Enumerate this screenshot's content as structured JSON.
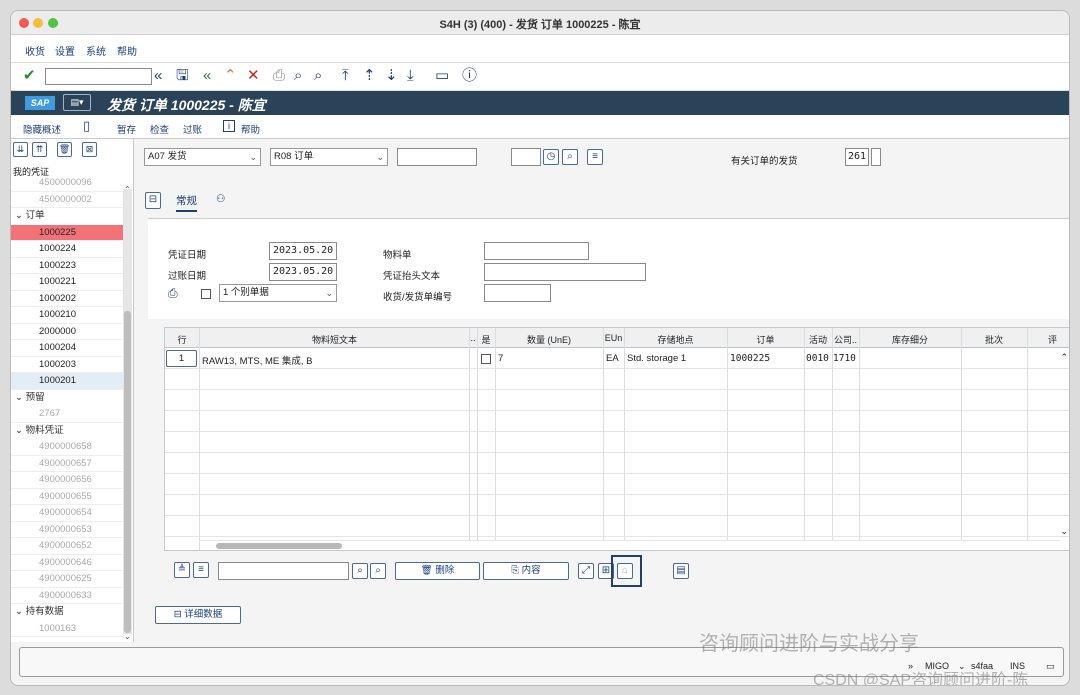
{
  "window": {
    "title": "S4H (3) (400) - 发货 订单 1000225 - 陈宜"
  },
  "menu": [
    "收货",
    "设置",
    "系统",
    "帮助"
  ],
  "sap": {
    "logo": "SAP",
    "title": "发货 订单 1000225 - 陈宜"
  },
  "app_toolbar": {
    "hide_overview": "隐藏概述",
    "hold": "暂存",
    "check": "检查",
    "post": "过账",
    "help": "帮助"
  },
  "left_pane": {
    "header": "我的凭证",
    "items": [
      {
        "label": "4500000096",
        "type": "leaf",
        "state": "dim"
      },
      {
        "label": "4500000002",
        "type": "leaf",
        "state": "dim"
      },
      {
        "label": "订单",
        "type": "node"
      },
      {
        "label": "1000225",
        "type": "leaf",
        "state": "selected"
      },
      {
        "label": "1000224",
        "type": "leaf",
        "state": "normal"
      },
      {
        "label": "1000223",
        "type": "leaf",
        "state": "normal"
      },
      {
        "label": "1000221",
        "type": "leaf",
        "state": "normal"
      },
      {
        "label": "1000202",
        "type": "leaf",
        "state": "normal"
      },
      {
        "label": "1000210",
        "type": "leaf",
        "state": "normal"
      },
      {
        "label": "2000000",
        "type": "leaf",
        "state": "normal"
      },
      {
        "label": "1000204",
        "type": "leaf",
        "state": "normal"
      },
      {
        "label": "1000203",
        "type": "leaf",
        "state": "normal"
      },
      {
        "label": "1000201",
        "type": "leaf",
        "state": "highlight"
      },
      {
        "label": "预留",
        "type": "node"
      },
      {
        "label": "2767",
        "type": "leaf",
        "state": "dim"
      },
      {
        "label": "物料凭证",
        "type": "node"
      },
      {
        "label": "4900000658",
        "type": "leaf",
        "state": "dim"
      },
      {
        "label": "4900000657",
        "type": "leaf",
        "state": "dim"
      },
      {
        "label": "4900000656",
        "type": "leaf",
        "state": "dim"
      },
      {
        "label": "4900000655",
        "type": "leaf",
        "state": "dim"
      },
      {
        "label": "4900000654",
        "type": "leaf",
        "state": "dim"
      },
      {
        "label": "4900000653",
        "type": "leaf",
        "state": "dim"
      },
      {
        "label": "4900000652",
        "type": "leaf",
        "state": "dim"
      },
      {
        "label": "4900000646",
        "type": "leaf",
        "state": "dim"
      },
      {
        "label": "4900000625",
        "type": "leaf",
        "state": "dim"
      },
      {
        "label": "4900000633",
        "type": "leaf",
        "state": "dim"
      },
      {
        "label": "持有数据",
        "type": "node"
      },
      {
        "label": "1000163",
        "type": "leaf",
        "state": "dim"
      }
    ]
  },
  "header": {
    "transaction": "A07 发货",
    "reference": "R08 订单",
    "ref_doc": "",
    "small_field": "",
    "goods_issue_label": "有关订单的发货",
    "movement_type": "261"
  },
  "tabs": {
    "general": "常规"
  },
  "form": {
    "doc_date_label": "凭证日期",
    "doc_date": "2023.05.20",
    "post_date_label": "过账日期",
    "post_date": "2023.05.20",
    "slip_option": "1 个别单据",
    "material_slip_label": "物料单",
    "material_slip": "",
    "header_text_label": "凭证抬头文本",
    "header_text": "",
    "bill_label": "收货/发货单编号",
    "bill": ""
  },
  "grid": {
    "headers": [
      "行",
      "物料短文本",
      "..",
      "是",
      "数量 (UnE)",
      "EUn",
      "存储地点",
      "订单",
      "活动",
      "公司..",
      "库存细分",
      "批次",
      "评"
    ],
    "rows": [
      {
        "line": "1",
        "text": "RAW13, MTS, ME 集成, B",
        "qty": "7",
        "unit": "EA",
        "sloc": "Std. storage 1",
        "order": "1000225",
        "activity": "0010",
        "company": "1710"
      }
    ]
  },
  "bottom": {
    "delete": "删除",
    "content": "内容",
    "detail": "详细数据"
  },
  "status": {
    "tcode": "MIGO",
    "server": "s4faa",
    "mode": "INS"
  },
  "watermark": {
    "line1": "咨询顾问进阶与实战分享",
    "line2": "CSDN @SAP咨询顾问进阶-陈"
  },
  "colors": {
    "sap_bar": "#2b4359",
    "selected_row": "#f27277",
    "link": "#1a3f7a"
  }
}
